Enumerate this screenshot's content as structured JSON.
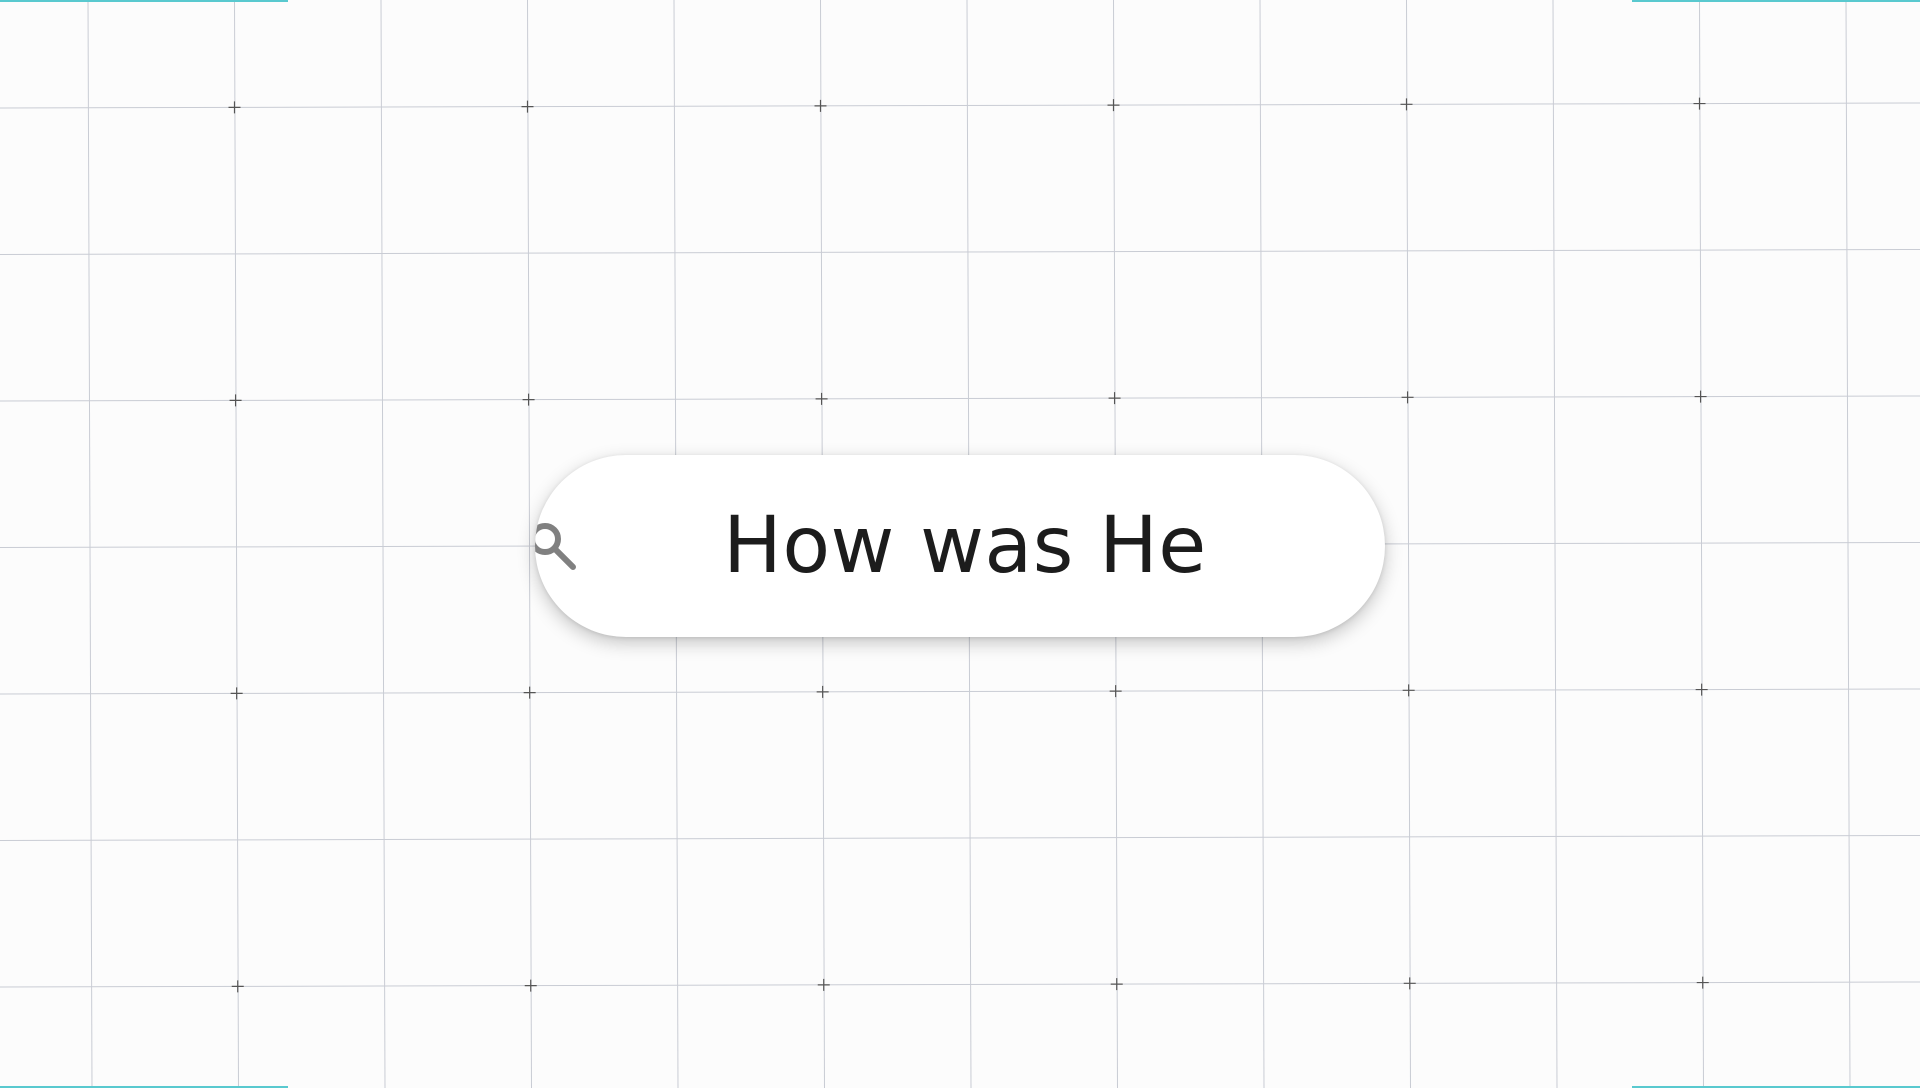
{
  "search": {
    "query": "How was He",
    "icon": "search-icon"
  },
  "colors": {
    "background": "#fcfcfc",
    "grid_line": "#c9ccd4",
    "grid_cross": "#555555",
    "corner_accent": "#59c9cf",
    "text": "#1c1c1c",
    "icon": "#808080"
  }
}
